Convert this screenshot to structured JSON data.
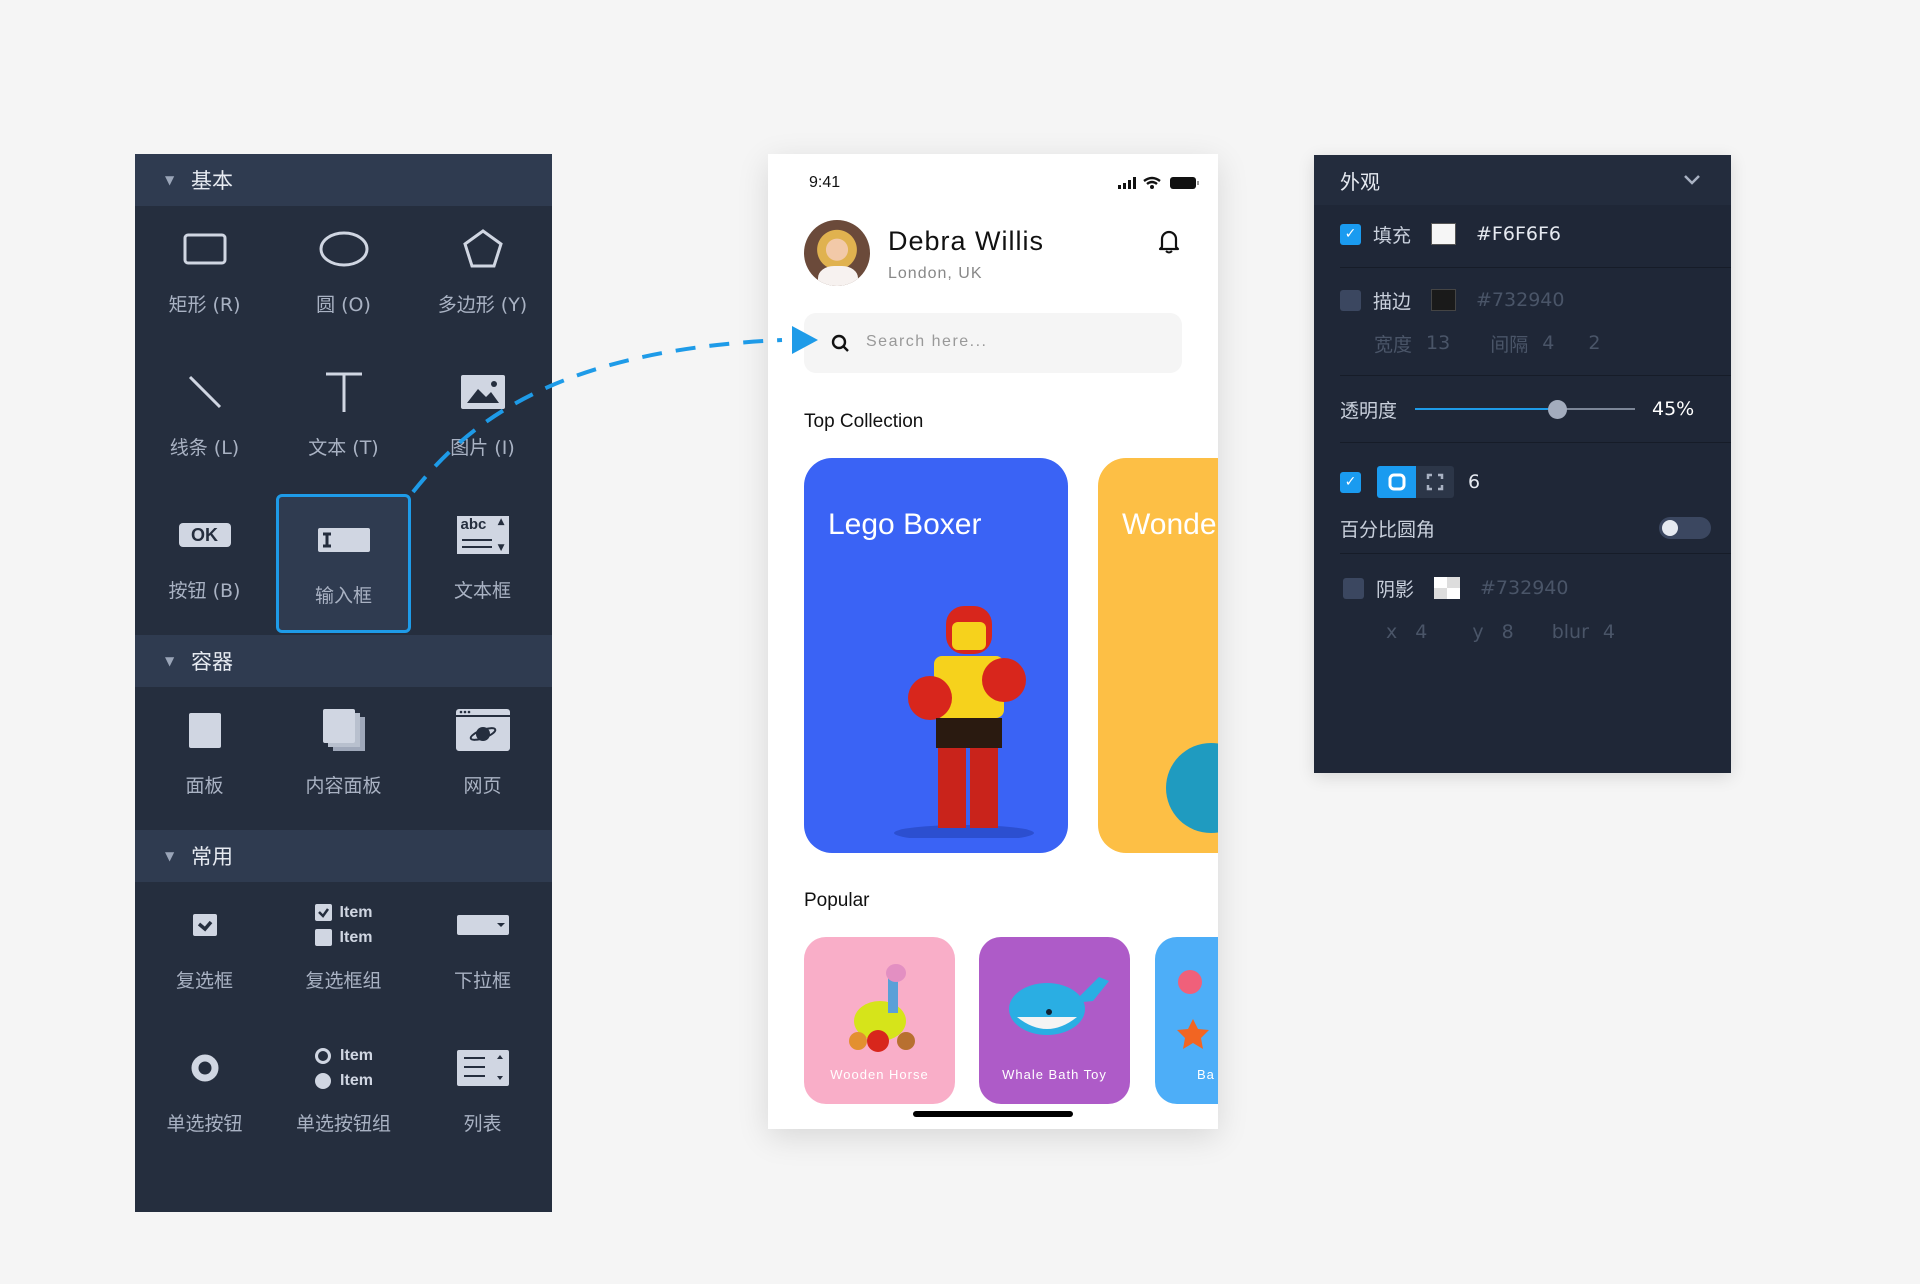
{
  "left_panel": {
    "sections": [
      {
        "title": "基本",
        "items": [
          {
            "label": "矩形 (R)",
            "icon": "rectangle-icon"
          },
          {
            "label": "圆 (O)",
            "icon": "ellipse-icon"
          },
          {
            "label": "多边形 (Y)",
            "icon": "polygon-icon"
          },
          {
            "label": "线条 (L)",
            "icon": "line-icon"
          },
          {
            "label": "文本 (T)",
            "icon": "text-icon"
          },
          {
            "label": "图片 (I)",
            "icon": "image-icon"
          },
          {
            "label": "按钮 (B)",
            "icon": "button-icon"
          },
          {
            "label": "输入框",
            "icon": "input-icon",
            "selected": true
          },
          {
            "label": "文本框",
            "icon": "textarea-icon"
          }
        ]
      },
      {
        "title": "容器",
        "items": [
          {
            "label": "面板",
            "icon": "panel-icon"
          },
          {
            "label": "内容面板",
            "icon": "content-panel-icon"
          },
          {
            "label": "网页",
            "icon": "webpage-icon"
          }
        ]
      },
      {
        "title": "常用",
        "items": [
          {
            "label": "复选框",
            "icon": "checkbox-icon"
          },
          {
            "label": "复选框组",
            "icon": "checkbox-group-icon"
          },
          {
            "label": "下拉框",
            "icon": "dropdown-icon"
          },
          {
            "label": "单选按钮",
            "icon": "radio-icon"
          },
          {
            "label": "单选按钮组",
            "icon": "radio-group-icon"
          },
          {
            "label": "列表",
            "icon": "list-icon"
          }
        ]
      }
    ],
    "icon_text": {
      "ok": "OK",
      "abc": "abc",
      "item": "Item"
    }
  },
  "phone": {
    "time": "9:41",
    "user_name": "Debra Willis",
    "location": "London, UK",
    "search_placeholder": "Search here...",
    "top_collection_title": "Top Collection",
    "collection": [
      {
        "title": "Lego Boxer",
        "color": "#3A63F5"
      },
      {
        "title": "Wonde",
        "color": "#FDBF45"
      }
    ],
    "popular_title": "Popular",
    "popular": [
      {
        "title": "Wooden Horse",
        "color": "#F9AEC8"
      },
      {
        "title": "Whale Bath Toy",
        "color": "#AE5BC8"
      },
      {
        "title": "Ba",
        "color": "#4DAEF8"
      }
    ]
  },
  "right_panel": {
    "title": "外观",
    "fill": {
      "checked": true,
      "label": "填充",
      "color": "#F6F6F6",
      "hex": "#F6F6F6"
    },
    "stroke": {
      "checked": false,
      "label": "描边",
      "color": "#1A1A1A",
      "hex": "#732940",
      "width_label": "宽度",
      "width": "13",
      "gap_label": "间隔",
      "gap": "4",
      "extra": "2"
    },
    "opacity": {
      "label": "透明度",
      "value": "45%"
    },
    "radius": {
      "checked": true,
      "value": "6"
    },
    "percent_radius": {
      "label": "百分比圆角",
      "on": false
    },
    "shadow": {
      "checked": false,
      "label": "阴影",
      "hex": "#732940",
      "x_label": "x",
      "x": "4",
      "y_label": "y",
      "y": "8",
      "blur_label": "blur",
      "blur": "4"
    }
  },
  "colors": {
    "accent": "#1E9BE8",
    "panel_bg": "#252E3E"
  }
}
